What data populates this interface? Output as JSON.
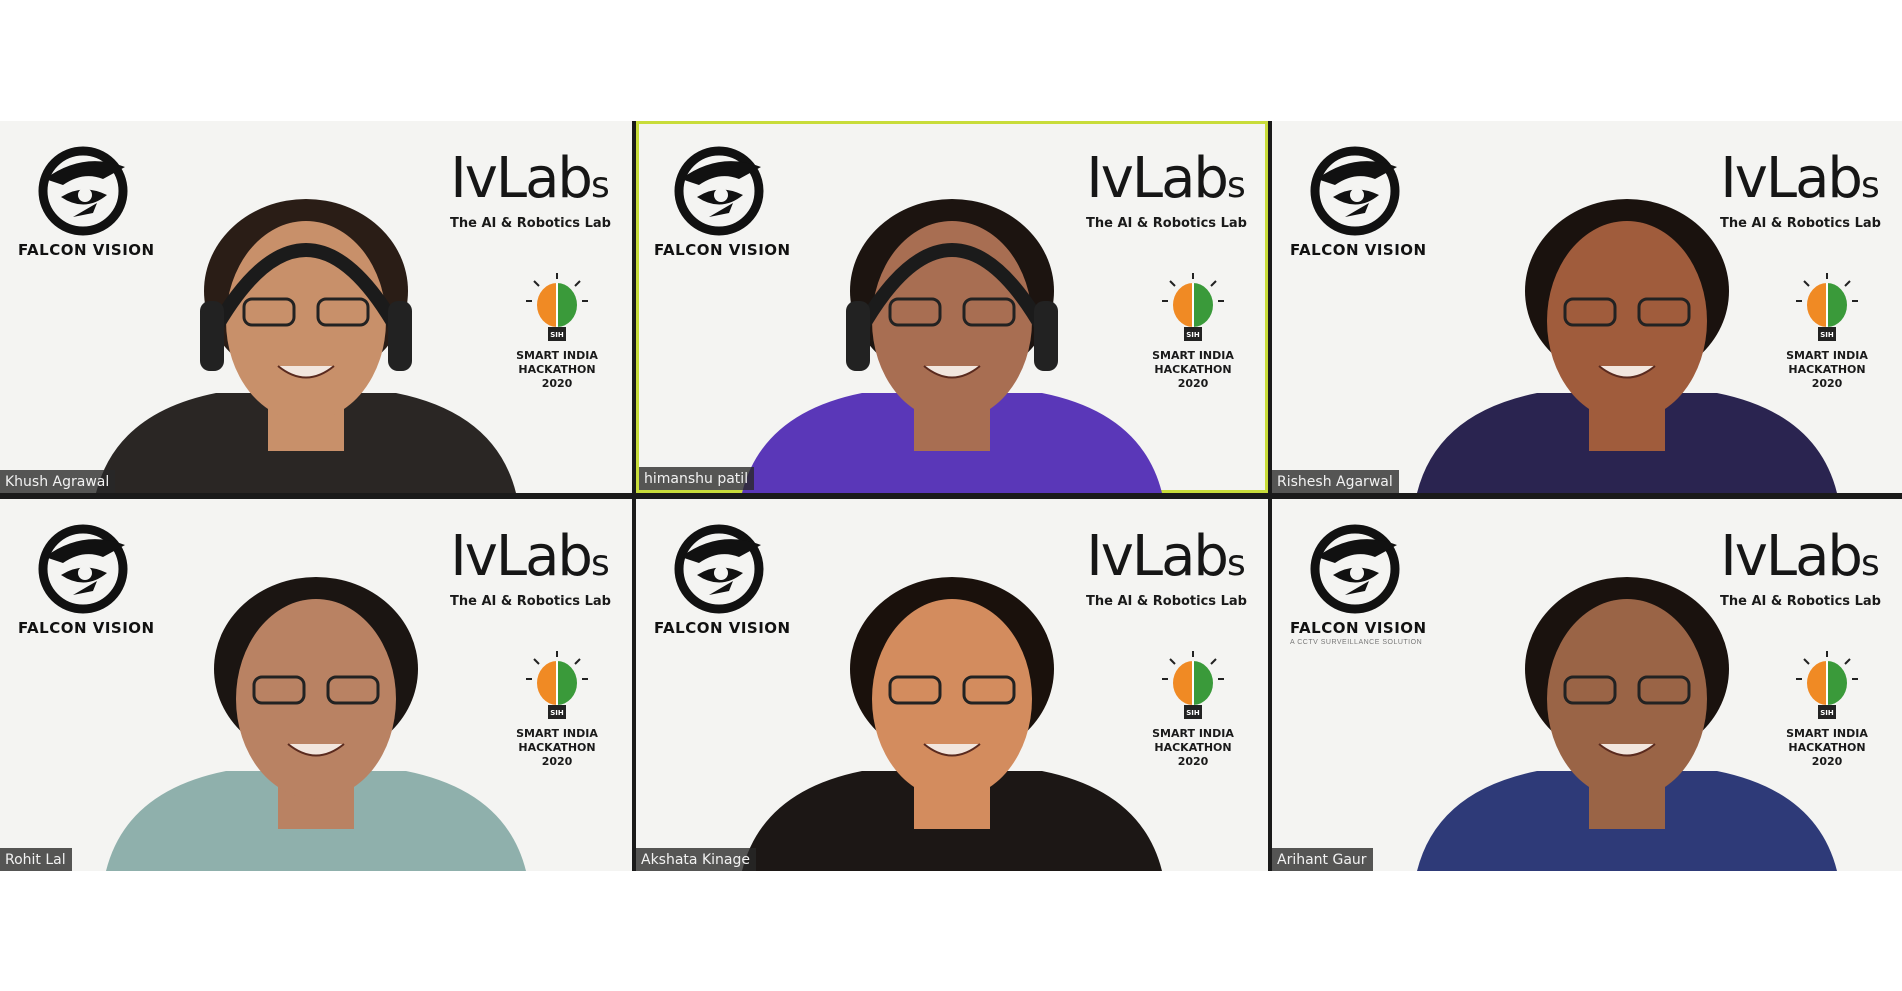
{
  "meeting": {
    "branding": {
      "falcon_vision_name": "FALCON VISION",
      "falcon_vision_tagline": "A CCTV SURVEILLANCE SOLUTION",
      "ivlabs_wordmark": "IvLab",
      "ivlabs_wordmark_s": "s",
      "ivlabs_subtitle": "The AI & Robotics Lab",
      "sih_line1": "SMART INDIA",
      "sih_line2": "HACKATHON",
      "sih_line3": "2020",
      "sih_badge": "SIH"
    },
    "participants": [
      {
        "name": "Khush Agrawal",
        "active": false,
        "shirt": "#2a2624",
        "skin": "#c8906a",
        "hair": "#2a1d16",
        "headphones": true
      },
      {
        "name": "himanshu patil",
        "active": true,
        "shirt": "#5a37b8",
        "skin": "#a86e52",
        "hair": "#1c1410",
        "headphones": true
      },
      {
        "name": "Rishesh Agarwal",
        "active": false,
        "shirt": "#2a2450",
        "skin": "#a05c3c",
        "hair": "#1a120e",
        "headphones": false
      },
      {
        "name": "Rohit Lal",
        "active": false,
        "shirt": "#8fb0ac",
        "skin": "#b98263",
        "hair": "#1b1512",
        "headphones": false
      },
      {
        "name": "Akshata Kinage",
        "active": false,
        "shirt": "#1c1715",
        "skin": "#d38c5e",
        "hair": "#1a110c",
        "headphones": false
      },
      {
        "name": "Arihant Gaur",
        "active": false,
        "shirt": "#2e3a78",
        "skin": "#9a6446",
        "hair": "#1a120e",
        "headphones": false
      }
    ],
    "colors": {
      "active_border": "#c8dc3a",
      "tile_bg": "#f4f4f2",
      "gutter": "#1a1a1a",
      "sih_saffron": "#f08a24",
      "sih_green": "#3a9a3a"
    }
  }
}
